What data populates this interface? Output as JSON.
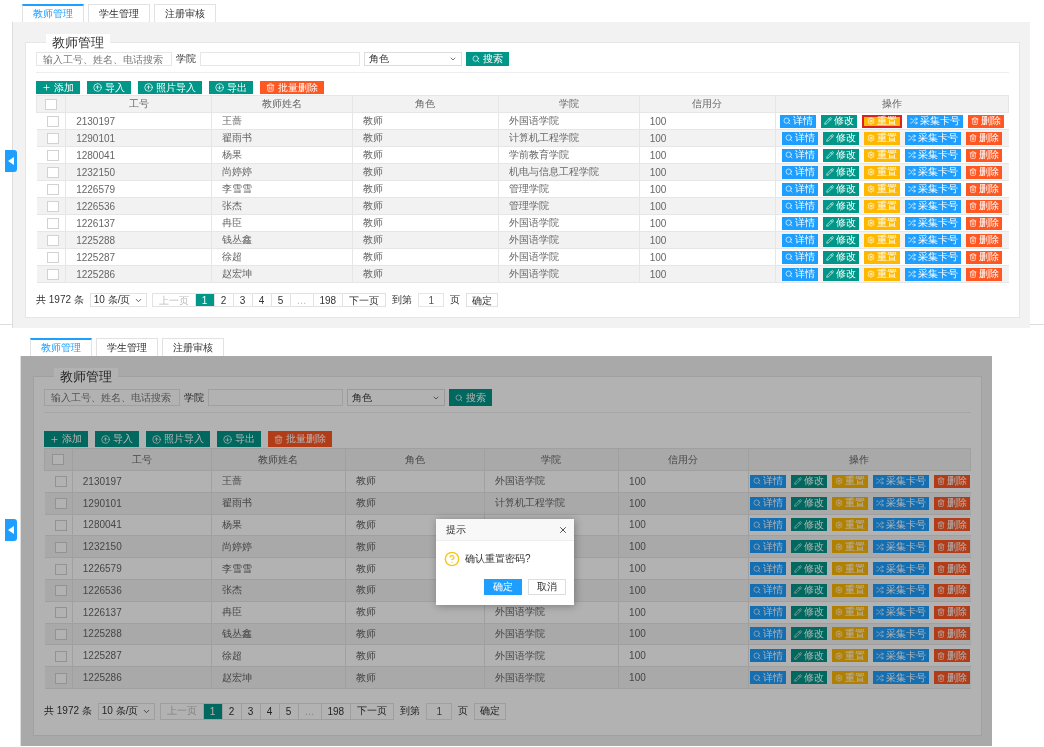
{
  "panels": [
    {
      "tabs": [
        {
          "label": "教师管理",
          "selected": true
        },
        {
          "label": "学生管理",
          "selected": false
        },
        {
          "label": "注册审核",
          "selected": false
        }
      ],
      "legend": "教师管理",
      "search": {
        "placeholder": "输入工号、姓名、电话搜索",
        "college_label": "学院",
        "role_select": "角色",
        "button": "搜索"
      },
      "toolbar": [
        {
          "kind": "add",
          "label": "添加"
        },
        {
          "kind": "import",
          "label": "导入"
        },
        {
          "kind": "photo_import",
          "label": "照片导入"
        },
        {
          "kind": "export",
          "label": "导出"
        },
        {
          "kind": "batch_delete",
          "label": "批量删除"
        }
      ],
      "table": {
        "select_all": false,
        "columns": [
          "工号",
          "教师姓名",
          "角色",
          "学院",
          "信用分",
          "操作"
        ],
        "rows": [
          {
            "checked": false,
            "id": "2130197",
            "name": "王蔷",
            "role": "教师",
            "college": "外国语学院",
            "credit": "100",
            "actions": [
              {
                "kind": "detail",
                "label": "详情",
                "outlined": false
              },
              {
                "kind": "edit",
                "label": "修改",
                "outlined": false
              },
              {
                "kind": "reset",
                "label": "重置",
                "outlined": true
              },
              {
                "kind": "collect",
                "label": "采集卡号",
                "outlined": false
              },
              {
                "kind": "delete",
                "label": "删除",
                "outlined": false
              }
            ]
          },
          {
            "checked": false,
            "id": "1290101",
            "name": "翟雨书",
            "role": "教师",
            "college": "计算机工程学院",
            "credit": "100",
            "actions": [
              {
                "kind": "detail",
                "label": "详情",
                "outlined": false
              },
              {
                "kind": "edit",
                "label": "修改",
                "outlined": false
              },
              {
                "kind": "reset",
                "label": "重置",
                "outlined": false
              },
              {
                "kind": "collect",
                "label": "采集卡号",
                "outlined": false
              },
              {
                "kind": "delete",
                "label": "删除",
                "outlined": false
              }
            ]
          },
          {
            "checked": false,
            "id": "1280041",
            "name": "杨果",
            "role": "教师",
            "college": "学前教育学院",
            "credit": "100",
            "actions": [
              {
                "kind": "detail",
                "label": "详情",
                "outlined": false
              },
              {
                "kind": "edit",
                "label": "修改",
                "outlined": false
              },
              {
                "kind": "reset",
                "label": "重置",
                "outlined": false
              },
              {
                "kind": "collect",
                "label": "采集卡号",
                "outlined": false
              },
              {
                "kind": "delete",
                "label": "删除",
                "outlined": false
              }
            ]
          },
          {
            "checked": false,
            "id": "1232150",
            "name": "尚婷婷",
            "role": "教师",
            "college": "机电与信息工程学院",
            "credit": "100",
            "actions": [
              {
                "kind": "detail",
                "label": "详情",
                "outlined": false
              },
              {
                "kind": "edit",
                "label": "修改",
                "outlined": false
              },
              {
                "kind": "reset",
                "label": "重置",
                "outlined": false
              },
              {
                "kind": "collect",
                "label": "采集卡号",
                "outlined": false
              },
              {
                "kind": "delete",
                "label": "删除",
                "outlined": false
              }
            ]
          },
          {
            "checked": false,
            "id": "1226579",
            "name": "李雪雪",
            "role": "教师",
            "college": "管理学院",
            "credit": "100",
            "actions": [
              {
                "kind": "detail",
                "label": "详情",
                "outlined": false
              },
              {
                "kind": "edit",
                "label": "修改",
                "outlined": false
              },
              {
                "kind": "reset",
                "label": "重置",
                "outlined": false
              },
              {
                "kind": "collect",
                "label": "采集卡号",
                "outlined": false
              },
              {
                "kind": "delete",
                "label": "删除",
                "outlined": false
              }
            ]
          },
          {
            "checked": false,
            "id": "1226536",
            "name": "张杰",
            "role": "教师",
            "college": "管理学院",
            "credit": "100",
            "actions": [
              {
                "kind": "detail",
                "label": "详情",
                "outlined": false
              },
              {
                "kind": "edit",
                "label": "修改",
                "outlined": false
              },
              {
                "kind": "reset",
                "label": "重置",
                "outlined": false
              },
              {
                "kind": "collect",
                "label": "采集卡号",
                "outlined": false
              },
              {
                "kind": "delete",
                "label": "删除",
                "outlined": false
              }
            ]
          },
          {
            "checked": false,
            "id": "1226137",
            "name": "冉臣",
            "role": "教师",
            "college": "外国语学院",
            "credit": "100",
            "actions": [
              {
                "kind": "detail",
                "label": "详情",
                "outlined": false
              },
              {
                "kind": "edit",
                "label": "修改",
                "outlined": false
              },
              {
                "kind": "reset",
                "label": "重置",
                "outlined": false
              },
              {
                "kind": "collect",
                "label": "采集卡号",
                "outlined": false
              },
              {
                "kind": "delete",
                "label": "删除",
                "outlined": false
              }
            ]
          },
          {
            "checked": false,
            "id": "1225288",
            "name": "钱丛鑫",
            "role": "教师",
            "college": "外国语学院",
            "credit": "100",
            "actions": [
              {
                "kind": "detail",
                "label": "详情",
                "outlined": false
              },
              {
                "kind": "edit",
                "label": "修改",
                "outlined": false
              },
              {
                "kind": "reset",
                "label": "重置",
                "outlined": false
              },
              {
                "kind": "collect",
                "label": "采集卡号",
                "outlined": false
              },
              {
                "kind": "delete",
                "label": "删除",
                "outlined": false
              }
            ]
          },
          {
            "checked": false,
            "id": "1225287",
            "name": "徐超",
            "role": "教师",
            "college": "外国语学院",
            "credit": "100",
            "actions": [
              {
                "kind": "detail",
                "label": "详情",
                "outlined": false
              },
              {
                "kind": "edit",
                "label": "修改",
                "outlined": false
              },
              {
                "kind": "reset",
                "label": "重置",
                "outlined": false
              },
              {
                "kind": "collect",
                "label": "采集卡号",
                "outlined": false
              },
              {
                "kind": "delete",
                "label": "删除",
                "outlined": false
              }
            ]
          },
          {
            "checked": false,
            "id": "1225286",
            "name": "赵宏坤",
            "role": "教师",
            "college": "外国语学院",
            "credit": "100",
            "actions": [
              {
                "kind": "detail",
                "label": "详情",
                "outlined": false
              },
              {
                "kind": "edit",
                "label": "修改",
                "outlined": false
              },
              {
                "kind": "reset",
                "label": "重置",
                "outlined": false
              },
              {
                "kind": "collect",
                "label": "采集卡号",
                "outlined": false
              },
              {
                "kind": "delete",
                "label": "删除",
                "outlined": false
              }
            ]
          }
        ]
      },
      "pagination": {
        "total": "共 1972 条",
        "page_size": "10 条/页",
        "pages": [
          {
            "label": "上一页",
            "selected": false,
            "disabled": true
          },
          {
            "label": "1",
            "selected": true,
            "disabled": false
          },
          {
            "label": "2",
            "selected": false,
            "disabled": false
          },
          {
            "label": "3",
            "selected": false,
            "disabled": false
          },
          {
            "label": "4",
            "selected": false,
            "disabled": false
          },
          {
            "label": "5",
            "selected": false,
            "disabled": false
          },
          {
            "label": "…",
            "selected": false,
            "disabled": true
          },
          {
            "label": "198",
            "selected": false,
            "disabled": false
          },
          {
            "label": "下一页",
            "selected": false,
            "disabled": false
          }
        ],
        "goto_label": "到第",
        "goto_value": "1",
        "page_unit": "页",
        "confirm": "确定"
      },
      "dimmed": false
    },
    {
      "tabs": [
        {
          "label": "教师管理",
          "selected": true
        },
        {
          "label": "学生管理",
          "selected": false
        },
        {
          "label": "注册审核",
          "selected": false
        }
      ],
      "legend": "教师管理",
      "search": {
        "placeholder": "输入工号、姓名、电话搜索",
        "college_label": "学院",
        "role_select": "角色",
        "button": "搜索"
      },
      "toolbar": [
        {
          "kind": "add",
          "label": "添加"
        },
        {
          "kind": "import",
          "label": "导入"
        },
        {
          "kind": "photo_import",
          "label": "照片导入"
        },
        {
          "kind": "export",
          "label": "导出"
        },
        {
          "kind": "batch_delete",
          "label": "批量删除"
        }
      ],
      "table": {
        "select_all": false,
        "columns": [
          "工号",
          "教师姓名",
          "角色",
          "学院",
          "信用分",
          "操作"
        ],
        "rows": [
          {
            "checked": false,
            "id": "2130197",
            "name": "王蔷",
            "role": "教师",
            "college": "外国语学院",
            "credit": "100",
            "actions": [
              {
                "kind": "detail",
                "label": "详情",
                "outlined": false
              },
              {
                "kind": "edit",
                "label": "修改",
                "outlined": false
              },
              {
                "kind": "reset",
                "label": "重置",
                "outlined": false
              },
              {
                "kind": "collect",
                "label": "采集卡号",
                "outlined": false
              },
              {
                "kind": "delete",
                "label": "删除",
                "outlined": false
              }
            ]
          },
          {
            "checked": false,
            "id": "1290101",
            "name": "翟雨书",
            "role": "教师",
            "college": "计算机工程学院",
            "credit": "100",
            "actions": [
              {
                "kind": "detail",
                "label": "详情",
                "outlined": false
              },
              {
                "kind": "edit",
                "label": "修改",
                "outlined": false
              },
              {
                "kind": "reset",
                "label": "重置",
                "outlined": false
              },
              {
                "kind": "collect",
                "label": "采集卡号",
                "outlined": false
              },
              {
                "kind": "delete",
                "label": "删除",
                "outlined": false
              }
            ]
          },
          {
            "checked": false,
            "id": "1280041",
            "name": "杨果",
            "role": "教师",
            "credit": "100",
            "actions": [
              {
                "kind": "detail",
                "label": "详情",
                "outlined": false
              },
              {
                "kind": "edit",
                "label": "修改",
                "outlined": false
              },
              {
                "kind": "reset",
                "label": "重置",
                "outlined": false
              },
              {
                "kind": "collect",
                "label": "采集卡号",
                "outlined": false
              },
              {
                "kind": "delete",
                "label": "删除",
                "outlined": false
              }
            ]
          },
          {
            "checked": false,
            "id": "1232150",
            "name": "尚婷婷",
            "role": "教师",
            "credit": "100",
            "actions": [
              {
                "kind": "detail",
                "label": "详情",
                "outlined": false
              },
              {
                "kind": "edit",
                "label": "修改",
                "outlined": false
              },
              {
                "kind": "reset",
                "label": "重置",
                "outlined": false
              },
              {
                "kind": "collect",
                "label": "采集卡号",
                "outlined": false
              },
              {
                "kind": "delete",
                "label": "删除",
                "outlined": false
              }
            ]
          },
          {
            "checked": false,
            "id": "1226579",
            "name": "李雪雪",
            "role": "教师",
            "credit": "100",
            "actions": [
              {
                "kind": "detail",
                "label": "详情",
                "outlined": false
              },
              {
                "kind": "edit",
                "label": "修改",
                "outlined": false
              },
              {
                "kind": "reset",
                "label": "重置",
                "outlined": false
              },
              {
                "kind": "collect",
                "label": "采集卡号",
                "outlined": false
              },
              {
                "kind": "delete",
                "label": "删除",
                "outlined": false
              }
            ]
          },
          {
            "checked": false,
            "id": "1226536",
            "name": "张杰",
            "role": "教师",
            "credit": "100",
            "actions": [
              {
                "kind": "detail",
                "label": "详情",
                "outlined": false
              },
              {
                "kind": "edit",
                "label": "修改",
                "outlined": false
              },
              {
                "kind": "reset",
                "label": "重置",
                "outlined": false
              },
              {
                "kind": "collect",
                "label": "采集卡号",
                "outlined": false
              },
              {
                "kind": "delete",
                "label": "删除",
                "outlined": false
              }
            ]
          },
          {
            "checked": false,
            "id": "1226137",
            "name": "冉臣",
            "role": "教师",
            "college": "外国语学院",
            "credit": "100",
            "actions": [
              {
                "kind": "detail",
                "label": "详情",
                "outlined": false
              },
              {
                "kind": "edit",
                "label": "修改",
                "outlined": false
              },
              {
                "kind": "reset",
                "label": "重置",
                "outlined": false
              },
              {
                "kind": "collect",
                "label": "采集卡号",
                "outlined": false
              },
              {
                "kind": "delete",
                "label": "删除",
                "outlined": false
              }
            ]
          },
          {
            "checked": false,
            "id": "1225288",
            "name": "钱丛鑫",
            "role": "教师",
            "college": "外国语学院",
            "credit": "100",
            "actions": [
              {
                "kind": "detail",
                "label": "详情",
                "outlined": false
              },
              {
                "kind": "edit",
                "label": "修改",
                "outlined": false
              },
              {
                "kind": "reset",
                "label": "重置",
                "outlined": false
              },
              {
                "kind": "collect",
                "label": "采集卡号",
                "outlined": false
              },
              {
                "kind": "delete",
                "label": "删除",
                "outlined": false
              }
            ]
          },
          {
            "checked": false,
            "id": "1225287",
            "name": "徐超",
            "role": "教师",
            "college": "外国语学院",
            "credit": "100",
            "actions": [
              {
                "kind": "detail",
                "label": "详情",
                "outlined": false
              },
              {
                "kind": "edit",
                "label": "修改",
                "outlined": false
              },
              {
                "kind": "reset",
                "label": "重置",
                "outlined": false
              },
              {
                "kind": "collect",
                "label": "采集卡号",
                "outlined": false
              },
              {
                "kind": "delete",
                "label": "删除",
                "outlined": false
              }
            ]
          },
          {
            "checked": false,
            "id": "1225286",
            "name": "赵宏坤",
            "role": "教师",
            "college": "外国语学院",
            "credit": "100",
            "actions": [
              {
                "kind": "detail",
                "label": "详情",
                "outlined": false
              },
              {
                "kind": "edit",
                "label": "修改",
                "outlined": false
              },
              {
                "kind": "reset",
                "label": "重置",
                "outlined": false
              },
              {
                "kind": "collect",
                "label": "采集卡号",
                "outlined": false
              },
              {
                "kind": "delete",
                "label": "删除",
                "outlined": false
              }
            ]
          }
        ]
      },
      "pagination": {
        "total": "共 1972 条",
        "page_size": "10 条/页",
        "pages": [
          {
            "label": "上一页",
            "selected": false,
            "disabled": true
          },
          {
            "label": "1",
            "selected": true,
            "disabled": false
          },
          {
            "label": "2",
            "selected": false,
            "disabled": false
          },
          {
            "label": "3",
            "selected": false,
            "disabled": false
          },
          {
            "label": "4",
            "selected": false,
            "disabled": false
          },
          {
            "label": "5",
            "selected": false,
            "disabled": false
          },
          {
            "label": "…",
            "selected": false,
            "disabled": true
          },
          {
            "label": "198",
            "selected": false,
            "disabled": false
          },
          {
            "label": "下一页",
            "selected": false,
            "disabled": false
          }
        ],
        "goto_label": "到第",
        "goto_value": "1",
        "page_unit": "页",
        "confirm": "确定"
      },
      "dimmed": true,
      "dialog": {
        "title": "提示",
        "message": "确认重置密码?",
        "buttons": [
          {
            "kind": "primary",
            "label": "确定"
          },
          {
            "kind": "default",
            "label": "取消"
          }
        ]
      }
    }
  ]
}
